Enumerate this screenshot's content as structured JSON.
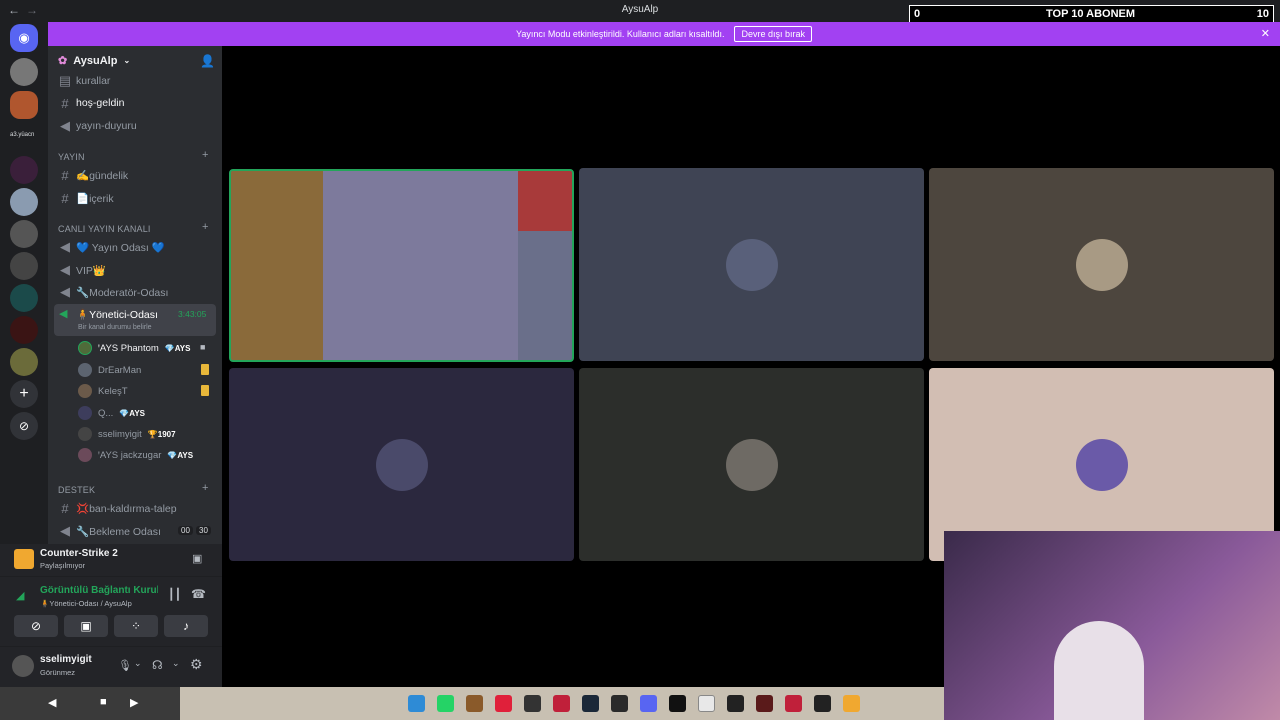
{
  "window": {
    "title": "AysuAlp",
    "overlay_left": "0",
    "overlay_title": "TOP 10 ABONEM",
    "overlay_right": "10"
  },
  "banner": {
    "text": "Yayıncı Modu etkinleştirildi. Kullanıcı adları kısaltıldı.",
    "button": "Devre dışı bırak"
  },
  "server": {
    "name": "AysuAlp"
  },
  "rail": {
    "label": "a3.yüacn"
  },
  "channels": {
    "kurallar": "kurallar",
    "hos_geldin": "hoş-geldin",
    "yayin_duyuru": "yayın-duyuru",
    "cat_yayin": "YAYIN",
    "gundelik": "✍️gündelik",
    "icerik": "📄içerik",
    "cat_canli": "CANLI YAYIN KANALI",
    "yayin_odasi": "💙 Yayın Odası 💙",
    "vip": "VIP👑",
    "moderator": "🔧Moderatör-Odası",
    "yonetici": "🧍Yönetici-Odası",
    "yonetici_timer": "3:43:05",
    "yonetici_status": "Bir kanal durumu belirle",
    "cat_destek": "DESTEK",
    "ban": "💢ban-kaldırma-talep",
    "bekleme": "🔧Bekleme Odası",
    "bekleme_c1": "00",
    "bekleme_c2": "30"
  },
  "voice_users": [
    {
      "name": "ꞌAYS Phantom",
      "tag": "💎AYS"
    },
    {
      "name": "DrEarMan",
      "tag": ""
    },
    {
      "name": "KeleşT",
      "tag": ""
    },
    {
      "name": "Q...",
      "tag": "💎AYS"
    },
    {
      "name": "sselimyigit",
      "tag": "🏆1907"
    },
    {
      "name": "ꞌAYS jackzugar",
      "tag": "💎AYS"
    }
  ],
  "activity": {
    "game": "Counter-Strike 2",
    "status": "Paylaşılmıyor"
  },
  "voice": {
    "status": "Görüntülü Bağlantı Kuruldu",
    "channel": "🧍Yönetici-Odası / AysuAlp"
  },
  "user": {
    "name": "sselimyigit",
    "status": "Görünmez"
  },
  "colors": {
    "accent": "#a241f2",
    "sidebar": "#2b2d31",
    "rail": "#1e1f22",
    "green": "#23a55a"
  }
}
